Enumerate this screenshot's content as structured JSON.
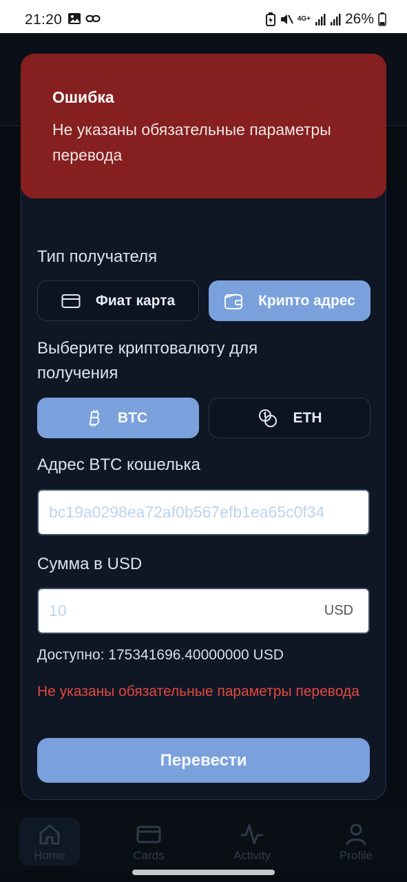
{
  "status_bar": {
    "time": "21:20",
    "network": "4G+",
    "battery": "26%",
    "icons": [
      "image-icon",
      "link-icon",
      "battery-saver-icon",
      "mute-icon",
      "signal-icon",
      "signal-icon",
      "battery-icon"
    ]
  },
  "toast": {
    "title": "Ошибка",
    "message": "Не указаны обязательные параметры перевода"
  },
  "form": {
    "recipient_type_label": "Тип получателя",
    "recipient_types": [
      {
        "label": "Фиат карта",
        "icon": "card-icon",
        "active": false
      },
      {
        "label": "Крипто адрес",
        "icon": "wallet-icon",
        "active": true
      }
    ],
    "crypto_label": "Выберите криптовалюту для получения",
    "cryptos": [
      {
        "label": "BTC",
        "icon": "bitcoin-icon",
        "active": true
      },
      {
        "label": "ETH",
        "icon": "coins-icon",
        "active": false
      }
    ],
    "address_label": "Адрес BTC кошелька",
    "address_placeholder": "bc19a0298ea72af0b567efb1ea65c0f34",
    "amount_label": "Сумма в USD",
    "amount_placeholder": "10",
    "amount_suffix": "USD",
    "available": "Доступно: 175341696.40000000 USD",
    "error": "Не указаны обязательные параметры перевода",
    "submit_label": "Перевести"
  },
  "bottom_nav": {
    "items": [
      {
        "label": "Home",
        "icon": "home-icon"
      },
      {
        "label": "Cards",
        "icon": "card-icon"
      },
      {
        "label": "Activity",
        "icon": "activity-icon"
      },
      {
        "label": "Profile",
        "icon": "profile-icon"
      }
    ]
  },
  "colors": {
    "accent": "#7ba1dc",
    "error_bg": "#861f1f",
    "error_text": "#e4463f",
    "sheet_bg": "#0f1724"
  }
}
